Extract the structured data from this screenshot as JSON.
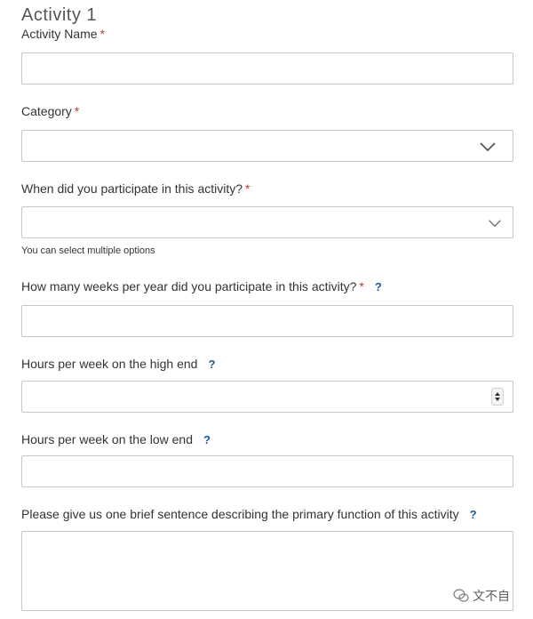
{
  "title": "Activity 1",
  "fields": {
    "activity_name": {
      "label": "Activity Name",
      "required": "*",
      "value": ""
    },
    "category": {
      "label": "Category",
      "required": "*",
      "value": ""
    },
    "participation": {
      "label": "When did you participate in this activity?",
      "required": "*",
      "value": "",
      "hint": "You can select multiple options"
    },
    "weeks_per_year": {
      "label": "How many weeks per year did you participate in this activity?",
      "required": "*",
      "help": "?",
      "value": ""
    },
    "hours_high": {
      "label": "Hours per week on the high end",
      "help": "?",
      "value": ""
    },
    "hours_low": {
      "label": "Hours per week on the low end",
      "help": "?",
      "value": ""
    },
    "description": {
      "label": "Please give us one brief sentence describing the primary function of this activity",
      "help": "?",
      "value": ""
    }
  },
  "icons": {
    "dropdown": "chevron-down-icon",
    "help": "question-icon",
    "spinner": "stepper-icon"
  },
  "watermark": {
    "text": "文不自"
  },
  "colors": {
    "required": "#c0392b",
    "help": "#1f5a96",
    "border": "#c7c7c7"
  }
}
